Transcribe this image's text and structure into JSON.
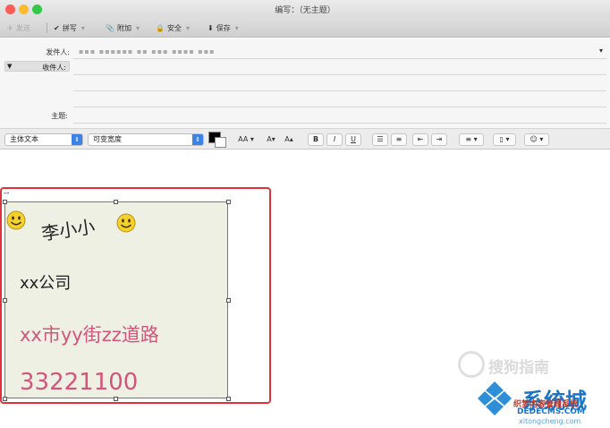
{
  "window": {
    "title": "编写：（无主题）",
    "traffic_colors": [
      "#fc5e57",
      "#fdbb2e",
      "#34c84a"
    ]
  },
  "toolbar": {
    "send": "发送",
    "spelling": "拼写",
    "attach": "附加",
    "security": "安全",
    "save": "保存",
    "dropdown": "▾"
  },
  "header": {
    "from_label": "发件人:",
    "from_value": "▪▪▪ ▪▪▪▪▪▪ ▪▪ ▪▪▪ ▪▪▪▪ ▪▪▪",
    "to_label": "收件人:",
    "subject_label": "主题:"
  },
  "format": {
    "style_select": "主体文本",
    "width_select": "可变宽度",
    "font_size": "AA",
    "shrink": "A▾",
    "grow": "A▴",
    "bold": "B",
    "italic": "I",
    "underline": "U",
    "color": "#000000"
  },
  "signature": {
    "dashes": "--",
    "name": "李小小",
    "company": "xx公司",
    "address": "xx市yy街zz道路",
    "phone": "33221100",
    "frame_color": "#e0323c",
    "text_accent": "#d2557a"
  },
  "watermarks": {
    "sogou": "搜狗指南",
    "logo_main": "系统城",
    "logo_sub": "织梦内容管理系统",
    "logo_url": "DEDECMS.COM",
    "logo_small": "xitongcheng.com"
  }
}
